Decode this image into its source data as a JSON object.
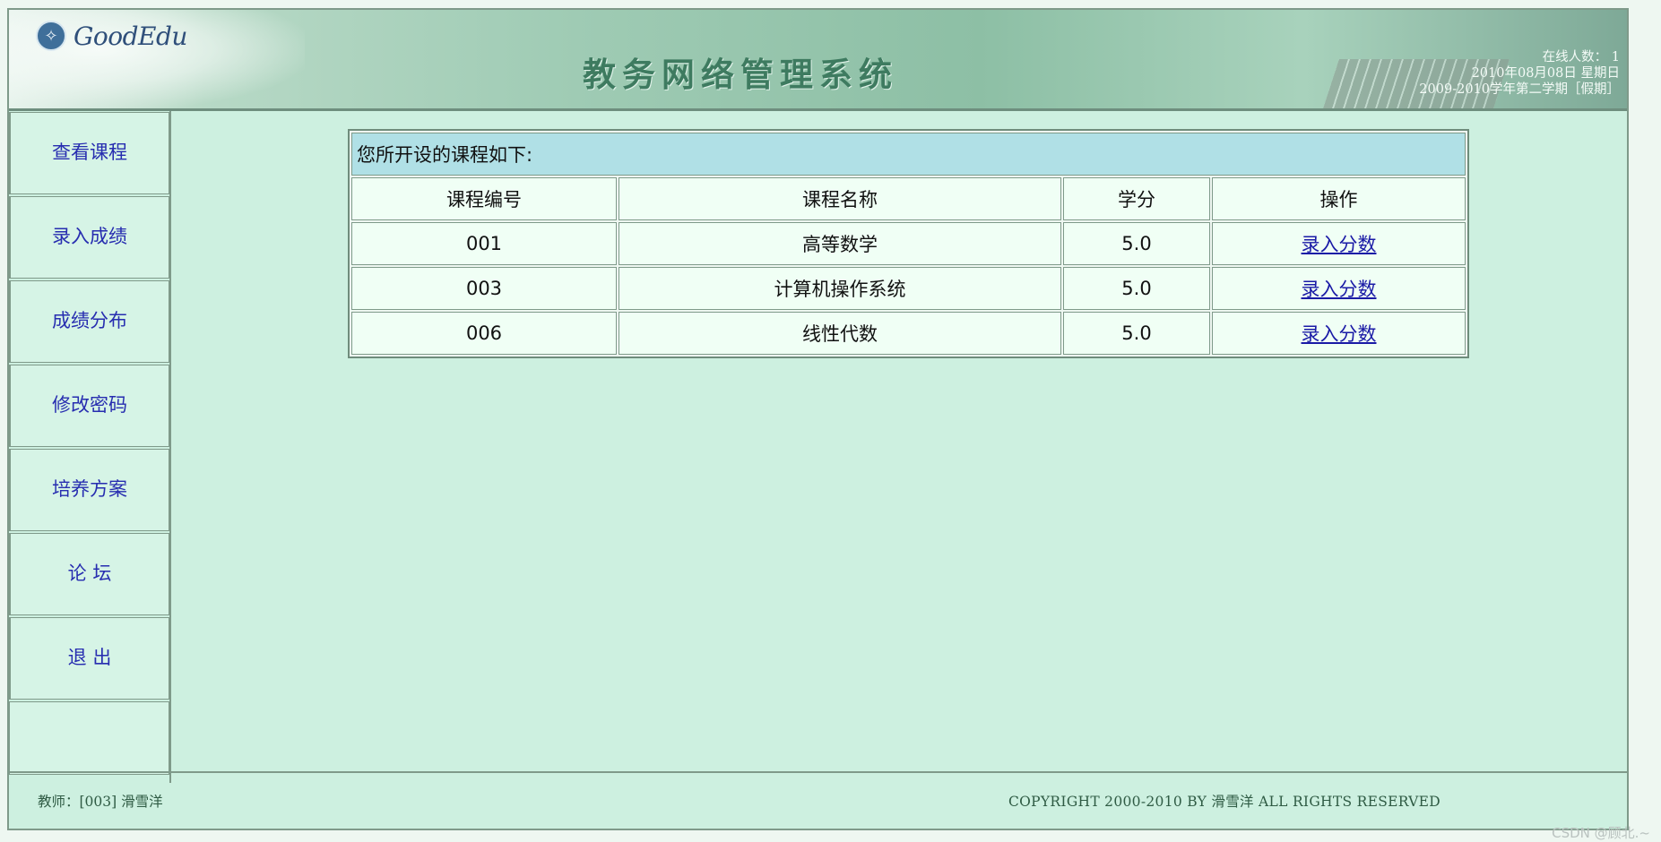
{
  "header": {
    "logo_text": "GoodEdu",
    "system_title": "教务网络管理系统",
    "online_users": "在线人数： 1",
    "date": "2010年08月08日 星期日",
    "term": "2009-2010学年第二学期［假期］"
  },
  "sidebar": {
    "items": [
      {
        "label": "查看课程"
      },
      {
        "label": "录入成绩"
      },
      {
        "label": "成绩分布"
      },
      {
        "label": "修改密码"
      },
      {
        "label": "培养方案"
      },
      {
        "label": "论 坛"
      },
      {
        "label": "退 出"
      }
    ]
  },
  "courses": {
    "caption": "您所开设的课程如下:",
    "columns": [
      "课程编号",
      "课程名称",
      "学分",
      "操作"
    ],
    "rows": [
      {
        "id": "001",
        "name": "高等数学",
        "credit": "5.0",
        "action": "录入分数"
      },
      {
        "id": "003",
        "name": "计算机操作系统",
        "credit": "5.0",
        "action": "录入分数"
      },
      {
        "id": "006",
        "name": "线性代数",
        "credit": "5.0",
        "action": "录入分数"
      }
    ]
  },
  "footer": {
    "teacher": "教师：[003] 滑雪洋",
    "copyright": "COPYRIGHT 2000-2010 BY  滑雪洋  ALL RIGHTS RESERVED"
  },
  "watermark": "CSDN @顾北.~",
  "colors": {
    "link": "#1a1aa6",
    "menu_text": "#272db0",
    "caption_bg": "#b0e0e6",
    "page_bg": "#cdf0e0"
  },
  "icons": {
    "logo": "goodedu-logo-icon"
  }
}
